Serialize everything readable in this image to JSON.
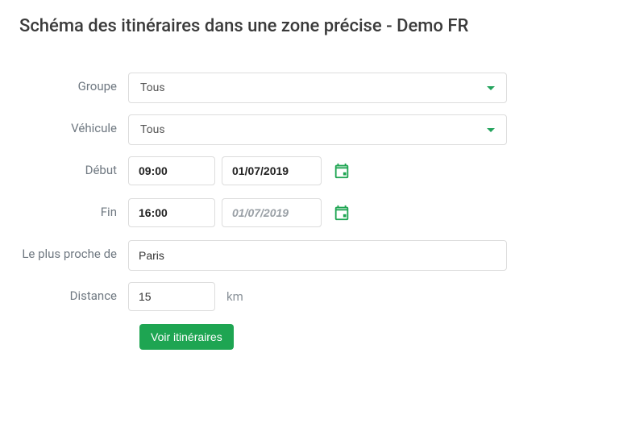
{
  "title": "Schéma des itinéraires dans une zone précise - Demo FR",
  "labels": {
    "groupe": "Groupe",
    "vehicule": "Véhicule",
    "debut": "Début",
    "fin": "Fin",
    "leplusproche": "Le plus proche de",
    "distance": "Distance"
  },
  "groupe": {
    "selected": "Tous"
  },
  "vehicule": {
    "selected": "Tous"
  },
  "debut": {
    "time": "09:00",
    "date": "01/07/2019"
  },
  "fin": {
    "time": "16:00",
    "date": "01/07/2019"
  },
  "proche": {
    "value": "Paris"
  },
  "distance": {
    "value": "15",
    "unit": "km"
  },
  "submit": {
    "label": "Voir itinéraires"
  }
}
